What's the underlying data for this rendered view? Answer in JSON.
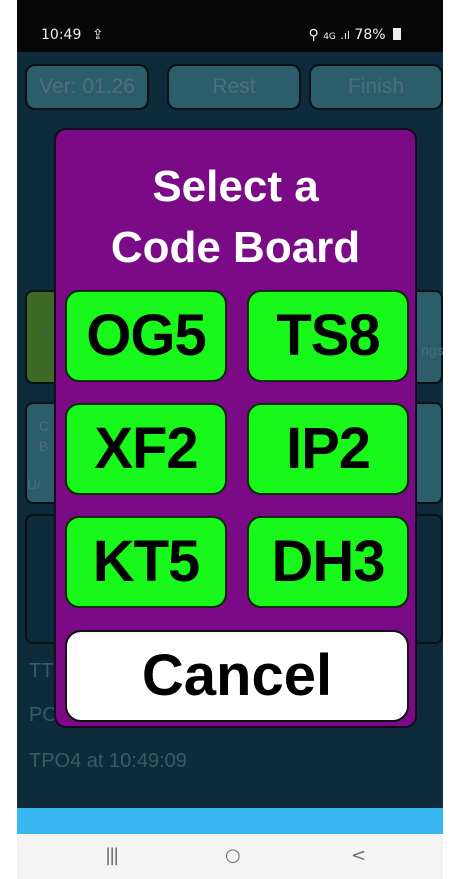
{
  "status_bar": {
    "time": "10:49",
    "notification_icon": "upload-icon",
    "network": "4G",
    "battery": "78%"
  },
  "app": {
    "top_buttons": [
      "Ver: 01.26",
      "Rest",
      "Finish"
    ],
    "log_lines": [
      "TT",
      "PO",
      "TPO4 at 10:49:09"
    ],
    "partial_labels": [
      "A",
      "2",
      "ngs",
      "C",
      "B",
      "U/"
    ]
  },
  "dialog": {
    "title_line1": "Select a",
    "title_line2": "Code Board",
    "code_options": [
      "OG5",
      "TS8",
      "XF2",
      "IP2",
      "KT5",
      "DH3"
    ],
    "cancel_label": "Cancel"
  },
  "nav_bar": {
    "recents": "|||",
    "home": "○",
    "back": "<"
  },
  "colors": {
    "dialog_background": "#7a0a86",
    "code_button": "#18f81a",
    "app_background": "#0d2b3a",
    "bottom_strip": "#38b6f1"
  }
}
